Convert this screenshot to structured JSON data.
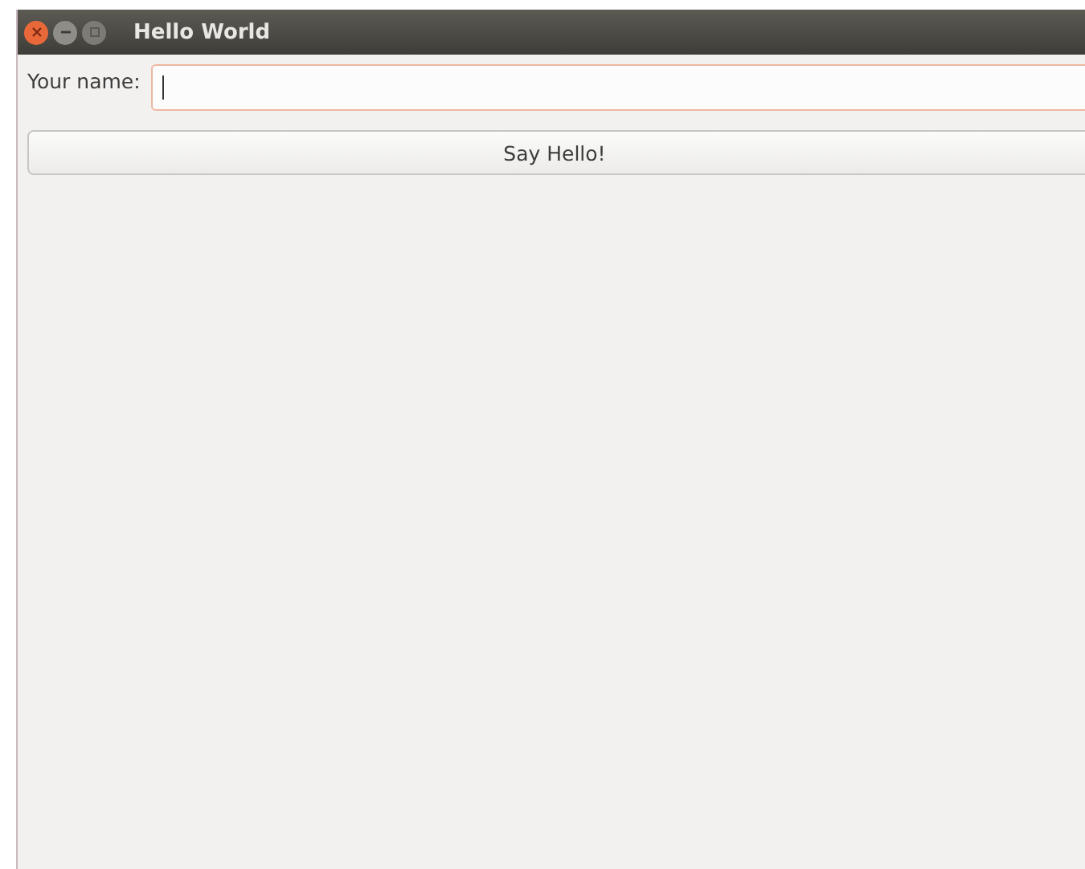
{
  "window": {
    "title": "Hello World"
  },
  "form": {
    "label": "Your name:",
    "field": {
      "focused": true
    }
  },
  "button": {
    "label": "Say Hello!"
  }
}
